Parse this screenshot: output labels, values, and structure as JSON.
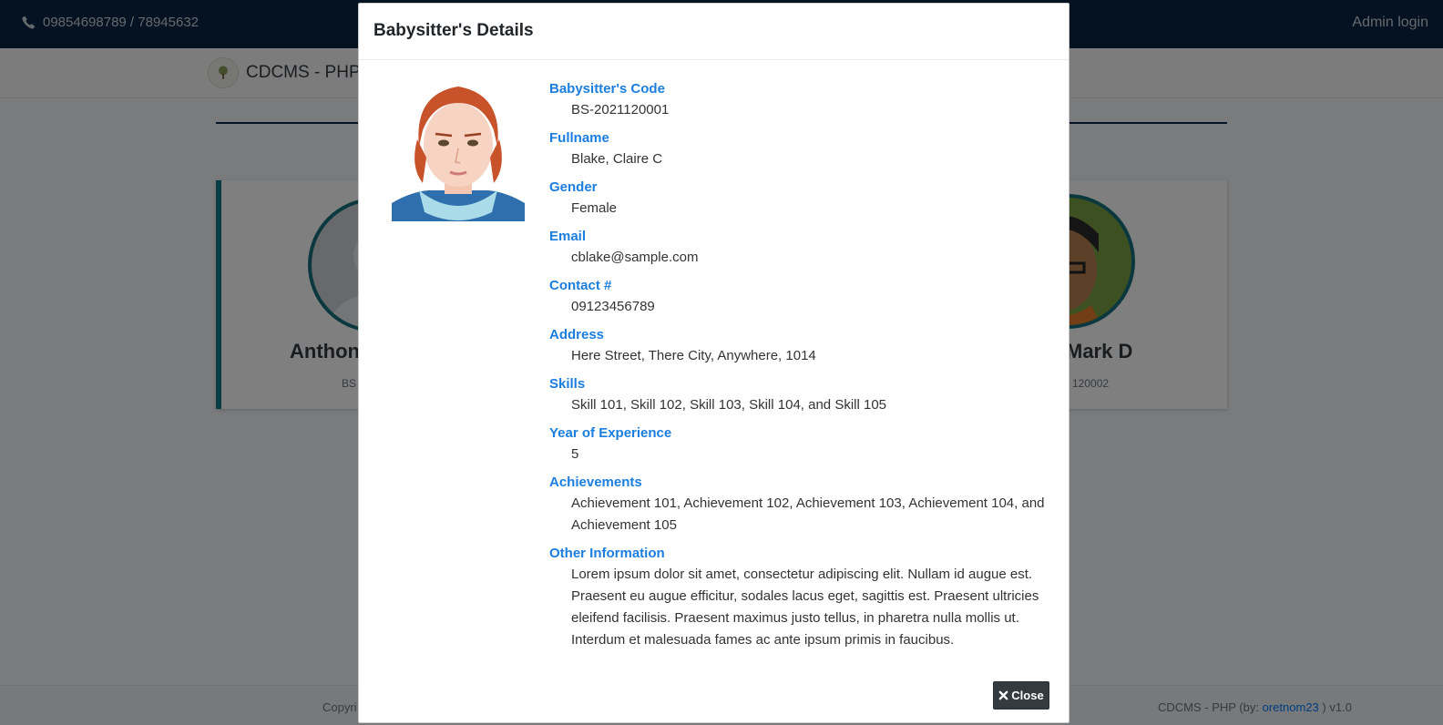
{
  "topbar": {
    "phone": "09854698789 / 78945632",
    "phone_icon": "phone-icon",
    "admin_login": "Admin login"
  },
  "navbar": {
    "brand": "CDCMS - PHP",
    "logo_icon": "tree-logo-icon"
  },
  "background_cards": [
    {
      "name": "Anthon",
      "code": "BS"
    },
    {
      "name": "Mark D",
      "code": "120002"
    }
  ],
  "footer": {
    "left": "Copyri",
    "right_prefix": "CDCMS - PHP (by:",
    "right_link": "oretnom23",
    "right_suffix": ") v1.0"
  },
  "modal": {
    "title": "Babysitter's Details",
    "close_label": "Close",
    "close_icon": "close-x-icon",
    "fields": [
      {
        "label": "Babysitter's Code",
        "value": "BS-2021120001"
      },
      {
        "label": "Fullname",
        "value": "Blake, Claire C"
      },
      {
        "label": "Gender",
        "value": "Female"
      },
      {
        "label": "Email",
        "value": "cblake@sample.com"
      },
      {
        "label": "Contact #",
        "value": "09123456789"
      },
      {
        "label": "Address",
        "value": "Here Street, There City, Anywhere, 1014"
      },
      {
        "label": "Skills",
        "value": "Skill 101, Skill 102, Skill 103, Skill 104, and Skill 105"
      },
      {
        "label": "Year of Experience",
        "value": "5"
      },
      {
        "label": "Achievements",
        "value": "Achievement 101, Achievement 102, Achievement 103, Achievement 104, and Achievement 105"
      },
      {
        "label": "Other Information",
        "value": "Lorem ipsum dolor sit amet, consectetur adipiscing elit. Nullam id augue est. Praesent eu augue efficitur, sodales lacus eget, sagittis est. Praesent ultricies eleifend facilisis. Praesent maximus justo tellus, in pharetra nulla mollis ut. Interdum et malesuada fames ac ante ipsum primis in faucibus."
      }
    ]
  },
  "colors": {
    "topbar": "#0b2542",
    "label_blue": "#1b7ee0",
    "close_button": "#343a40",
    "card_accent": "#117a8b"
  }
}
